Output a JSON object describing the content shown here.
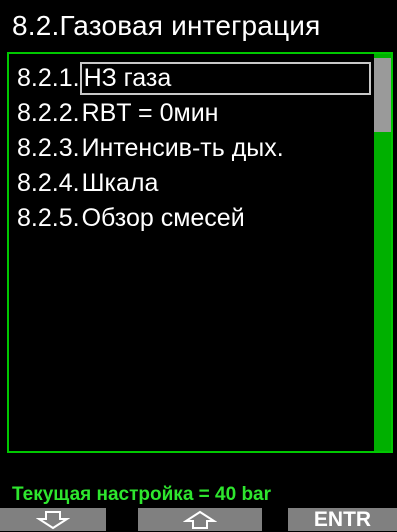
{
  "header": {
    "title": "8.2.Газовая интеграция"
  },
  "menu": {
    "items": [
      {
        "number": "8.2.1.",
        "label": "НЗ газа",
        "selected": true
      },
      {
        "number": "8.2.2.",
        "label": "RBT = 0мин",
        "selected": false
      },
      {
        "number": "8.2.3.",
        "label": "Интенсив-ть дых.",
        "selected": false
      },
      {
        "number": "8.2.4.",
        "label": "Шкала",
        "selected": false
      },
      {
        "number": "8.2.5.",
        "label": "Обзор смесей",
        "selected": false
      }
    ]
  },
  "status": {
    "text": "Текущая настройка = 40 bar"
  },
  "softkeys": {
    "down_icon": "arrow-down-icon",
    "up_icon": "arrow-up-icon",
    "enter_label": "ENTR"
  },
  "colors": {
    "background": "#000000",
    "border_green": "#00c800",
    "status_green": "#2ee62e",
    "softkey_gray": "#808080",
    "selection_border": "#c8c8c8",
    "scroll_thumb": "#9a9a9a"
  }
}
